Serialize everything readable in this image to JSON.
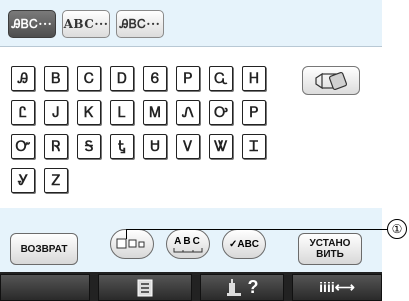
{
  "tabs": [
    {
      "label": "ᎯᏴᏟ···",
      "active": true
    },
    {
      "label": "ABC···",
      "active": false
    },
    {
      "label": "ᎯᏴᏟ···",
      "active": false
    }
  ],
  "keys": [
    [
      "Ꭿ",
      "Ᏼ",
      "Ꮯ",
      "Ꭰ",
      "Ꮾ",
      "Ꮲ",
      "Ꮹ",
      "Ꮋ"
    ],
    [
      "Ꮭ",
      "Ꭻ",
      "Ꮶ",
      "Ꮮ",
      "Ꮇ",
      "Ꮑ",
      "Ꭴ",
      "Ꮲ"
    ],
    [
      "Ꮕ",
      "Ꮢ",
      "Ꭶ",
      "Ꮏ",
      "Ꮜ",
      "Ꮩ",
      "Ꮤ",
      "Ꮖ"
    ],
    [
      "Ꮍ",
      "Ꮓ"
    ]
  ],
  "controls": {
    "back_label": "ВОЗВРАТ",
    "abc_label": "ABC",
    "check_abc_label": "✓ABC",
    "set_label_line1": "УСТАНО",
    "set_label_line2": "ВИТЬ"
  },
  "bottom_bar": {
    "help_label": "?",
    "width_label": "iiii⟷"
  },
  "callout": "①",
  "icons": {
    "erase": "eraser-icon",
    "size_toggle": "size-squares-icon",
    "spacing": "letter-spacing-icon",
    "list": "list-icon",
    "help": "embroidery-help-icon",
    "width": "width-arrows-icon"
  },
  "colors": {
    "panel_bg": "#e6f3fb",
    "active_tab": "#5e5e5e",
    "bottom_bar": "#222222"
  }
}
